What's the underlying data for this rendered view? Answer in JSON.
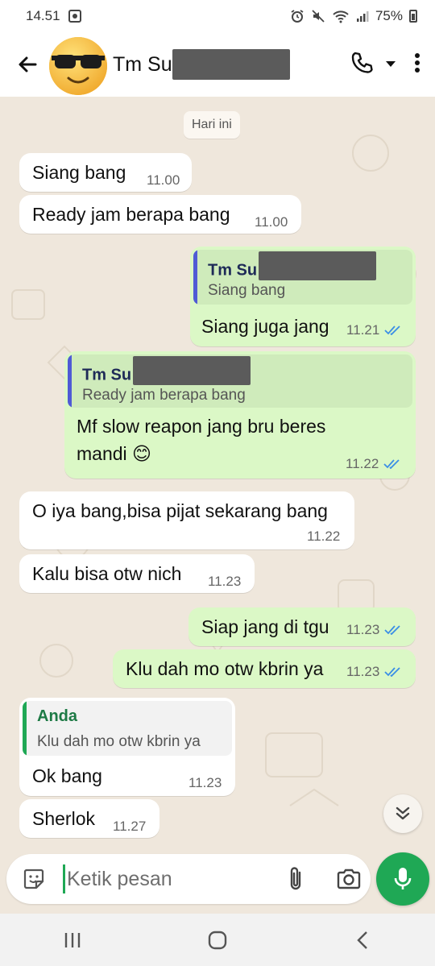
{
  "status": {
    "time": "14.51",
    "battery": "75%"
  },
  "header": {
    "contact_name": "Tm Su",
    "avatar_emoji": "😎"
  },
  "chat": {
    "date_chip": "Hari ini",
    "messages": [
      {
        "dir": "in",
        "text": "Siang bang",
        "time": "11.00"
      },
      {
        "dir": "in",
        "text": "Ready jam berapa bang",
        "time": "11.00"
      },
      {
        "dir": "out",
        "quote_name": "Tm Su",
        "quote_text": "Siang bang",
        "text": "Siang juga jang",
        "time": "11.21"
      },
      {
        "dir": "out",
        "quote_name": "Tm Su",
        "quote_text": "Ready jam berapa bang",
        "text_line1": "Mf slow reapon jang bru beres",
        "text_line2": "mandi",
        "emoji": "😊",
        "time": "11.22"
      },
      {
        "dir": "in",
        "text": "O iya bang,bisa pijat sekarang bang",
        "time": "11.22"
      },
      {
        "dir": "in",
        "text": "Kalu bisa otw nich",
        "time": "11.23"
      },
      {
        "dir": "out",
        "text": "Siap jang di tgu",
        "time": "11.23"
      },
      {
        "dir": "out",
        "text": "Klu dah mo otw kbrin ya",
        "time": "11.23"
      },
      {
        "dir": "in",
        "quote_name": "Anda",
        "quote_text": "Klu dah mo otw kbrin ya",
        "text": "Ok bang",
        "time": "11.23"
      },
      {
        "dir": "in",
        "text": "Sherlok",
        "time": "11.27"
      }
    ]
  },
  "input": {
    "placeholder": "Ketik pesan"
  },
  "colors": {
    "accent": "#1fa855",
    "outgoing": "#dbf8c6",
    "tick": "#3a8ee6",
    "quote_in_bar": "#1fa855",
    "quote_out_bar": "#4f5bd5"
  },
  "icons": [
    "back-arrow-icon",
    "phone-icon",
    "dropdown-icon",
    "more-vert-icon",
    "double-chevron-down-icon",
    "sticker-icon",
    "attach-icon",
    "camera-icon",
    "mic-icon",
    "recents-icon",
    "home-icon",
    "back-nav-icon"
  ]
}
